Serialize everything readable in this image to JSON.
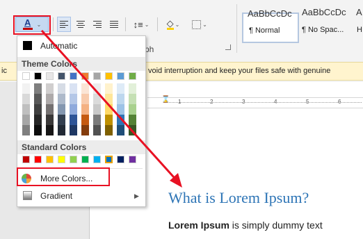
{
  "ribbon": {
    "font_color_letter": "A",
    "paragraph_group_label": "ph",
    "styles": [
      {
        "preview": "AaBbCcDc",
        "name": "¶ Normal"
      },
      {
        "preview": "AaBbCcDc",
        "name": "¶ No Spac..."
      },
      {
        "preview": "A",
        "name": "H"
      }
    ]
  },
  "infobar": {
    "prefix": "ic",
    "text": "void interruption and keep your files safe with genuine"
  },
  "ruler": {
    "ticks": [
      "1",
      "2",
      "3",
      "4",
      "5",
      "6"
    ]
  },
  "menu": {
    "automatic_label": "Automatic",
    "theme_colors_heading": "Theme Colors",
    "standard_colors_heading": "Standard Colors",
    "more_colors_label": "More Colors...",
    "gradient_label": "Gradient",
    "theme_top_row": [
      "#ffffff",
      "#000000",
      "#e7e6e6",
      "#44546a",
      "#4472c4",
      "#ed7d31",
      "#a5a5a5",
      "#ffc000",
      "#5b9bd5",
      "#70ad47"
    ],
    "theme_shades": [
      [
        "#f2f2f2",
        "#d9d9d9",
        "#bfbfbf",
        "#a6a6a6",
        "#7f7f7f"
      ],
      [
        "#7f7f7f",
        "#595959",
        "#404040",
        "#262626",
        "#0d0d0d"
      ],
      [
        "#d0cece",
        "#aeaaaa",
        "#757171",
        "#3a3838",
        "#171616"
      ],
      [
        "#d6dce5",
        "#adb9ca",
        "#8497b0",
        "#333f50",
        "#222a35"
      ],
      [
        "#d9e2f3",
        "#b4c7e7",
        "#8faadc",
        "#2f5597",
        "#1f3864"
      ],
      [
        "#fbe5d6",
        "#f8cbad",
        "#f4b183",
        "#c55a11",
        "#843c0c"
      ],
      [
        "#ededed",
        "#dbdbdb",
        "#c9c9c9",
        "#7b7b7b",
        "#525252"
      ],
      [
        "#fff2cc",
        "#ffe699",
        "#ffd966",
        "#bf9000",
        "#7f6000"
      ],
      [
        "#deebf7",
        "#bdd7ee",
        "#9dc3e6",
        "#2e75b6",
        "#1f4e79"
      ],
      [
        "#e2f0d9",
        "#c5e0b4",
        "#a9d18e",
        "#548235",
        "#385723"
      ]
    ],
    "standard_colors": [
      "#c00000",
      "#ff0000",
      "#ffc000",
      "#ffff00",
      "#92d050",
      "#00b050",
      "#00b0f0",
      "#0070c0",
      "#002060",
      "#7030a0"
    ]
  },
  "document": {
    "heading": "What is Lorem Ipsum?",
    "body_bold": "Lorem Ipsum",
    "body_rest": " is simply dummy text"
  },
  "annotation_color": "#e81123"
}
